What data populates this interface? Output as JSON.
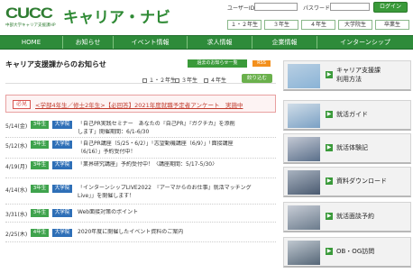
{
  "header": {
    "logo_mark": "CUCC",
    "logo_sub": "中部大学キャリア支援課HP",
    "site_title": "キャリア・ナビ",
    "user_id_label": "ユーザーID",
    "password_label": "パスワード",
    "login_button": "ログイン",
    "grades": [
      "１・２年生",
      "３年生",
      "４年生",
      "大学院生",
      "卒業生"
    ]
  },
  "nav": {
    "items": [
      "HOME",
      "お知らせ",
      "イベント情報",
      "求人情報",
      "企業情報",
      "インターンシップ"
    ]
  },
  "main": {
    "title": "キャリア支援課からのお知らせ",
    "past_button": "過去のお知らせ一覧",
    "rss": "RSS",
    "filter_options": [
      "１・２年生",
      "３年生",
      "４年生"
    ],
    "filter_button": "絞り込む",
    "featured": {
      "badge": "必見",
      "text": "<学部4年生／修士2年生>【必回答】2021年度就職予定者アンケート　実施中"
    },
    "news": [
      {
        "date": "5/14(金)",
        "grade": "3年生",
        "group": "大学院",
        "lines": [
          "「自己PR実践セミナー　あなたの『自己PR』『ガクチカ』を添削",
          "します」開催期間：6/1-6/30"
        ]
      },
      {
        "date": "5/12(水)",
        "grade": "3年生",
        "group": "大学院",
        "lines": [
          "「自己PR講座（5/25・6/2）」「志望動機講座（6/9）」「面接講座",
          "（6/16）」予約受付中！"
        ]
      },
      {
        "date": "4/19(月)",
        "grade": "3年生",
        "group": "大学院",
        "lines": [
          "「業界研究講座」予約受付中！〈講座期間：5/17-5/30〉"
        ]
      },
      {
        "date": "4/14(水)",
        "grade": "3年生",
        "group": "大学院",
        "lines": [
          "「インターンシップLIVE2022　『アーマからのお仕事』就活マッチング",
          "Live」」を開催します！"
        ]
      },
      {
        "date": "3/31(水)",
        "grade": "3年生",
        "group": "大学院",
        "lines": [
          "Web面接対策のポイント"
        ]
      },
      {
        "date": "2/25(木)",
        "grade": "4年生",
        "group": "大学院",
        "lines": [
          "2020年度に開催したイベント資料のご案内"
        ]
      }
    ]
  },
  "sidebar": {
    "items": [
      {
        "label_lines": [
          "キャリア支援課",
          "利用方法"
        ],
        "icon": "building-photo"
      },
      {
        "label_lines": [
          "就活ガイド"
        ],
        "icon": "notebook-photo"
      },
      {
        "label_lines": [
          "就活体験記"
        ],
        "icon": "students-photo"
      },
      {
        "label_lines": [
          "資料ダウンロード"
        ],
        "icon": "files-photo"
      },
      {
        "label_lines": [
          "就活面談予約"
        ],
        "icon": "interview-photo"
      },
      {
        "label_lines": [
          "OB・OG訪問"
        ],
        "icon": "alumni-photo"
      }
    ]
  },
  "colors": {
    "brand_green": "#2e8b3a",
    "tag_grade": "#3fa34d",
    "tag_group": "#2e6fb7",
    "featured_red": "#c0392b"
  }
}
